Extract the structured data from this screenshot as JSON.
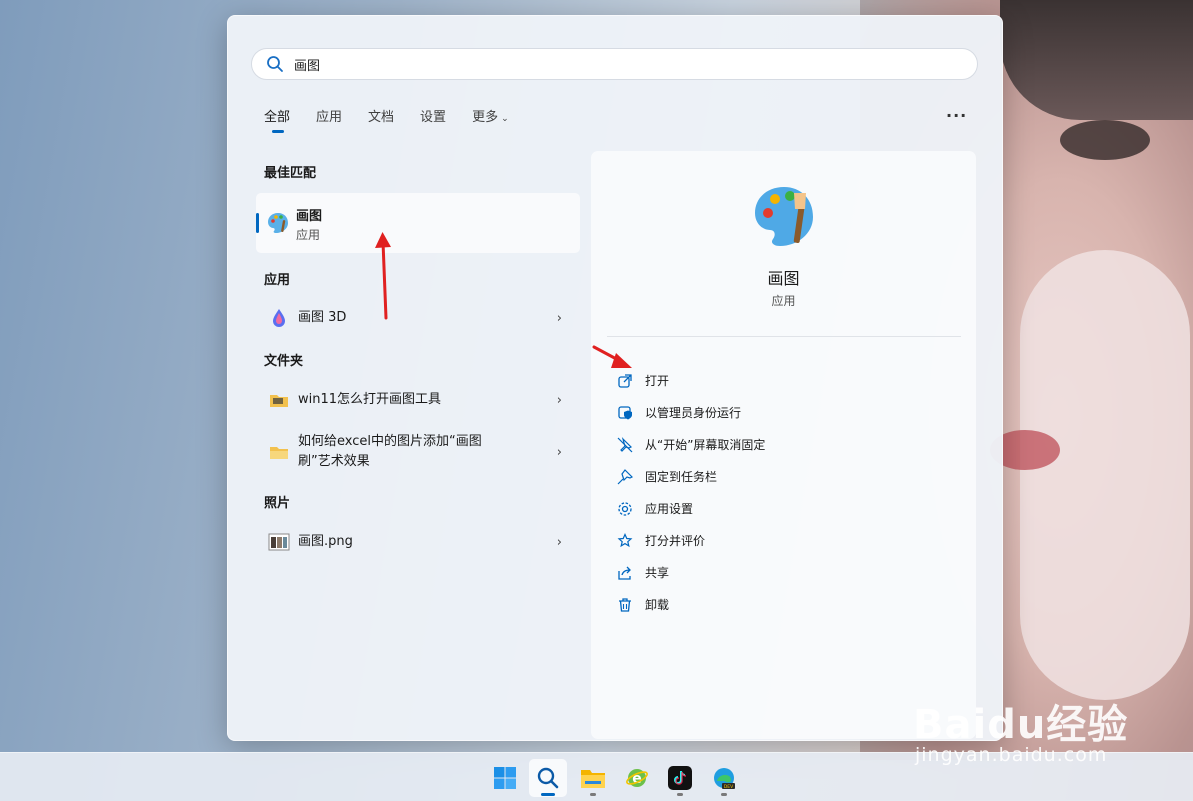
{
  "search": {
    "query": "画图"
  },
  "filters": {
    "tabs": [
      "全部",
      "应用",
      "文档",
      "设置",
      "更多"
    ],
    "more_menu": "..."
  },
  "results": {
    "best_match_title": "最佳匹配",
    "best_match": {
      "name": "画图",
      "type": "应用"
    },
    "apps_title": "应用",
    "apps": [
      {
        "name": "画图 3D"
      }
    ],
    "folders_title": "文件夹",
    "folders": [
      {
        "name": "win11怎么打开画图工具"
      },
      {
        "name_line1": "如何给excel中的图片添加“画图",
        "name_line2": "刷”艺术效果"
      }
    ],
    "photos_title": "照片",
    "photos": [
      {
        "name": "画图.png"
      }
    ]
  },
  "detail": {
    "app_name": "画图",
    "app_type": "应用",
    "actions": [
      "打开",
      "以管理员身份运行",
      "从“开始”屏幕取消固定",
      "固定到任务栏",
      "应用设置",
      "打分并评价",
      "共享",
      "卸载"
    ]
  },
  "taskbar": {
    "icons": [
      "windows-start-icon",
      "search-icon",
      "file-explorer-icon",
      "ie-browser-icon",
      "tiktok-icon",
      "edge-dev-icon"
    ]
  },
  "watermark": {
    "brand": "Baidu经验",
    "url": "jingyan.baidu.com"
  },
  "colors": {
    "accent": "#0067c0",
    "annotation_arrow": "#e02020"
  }
}
